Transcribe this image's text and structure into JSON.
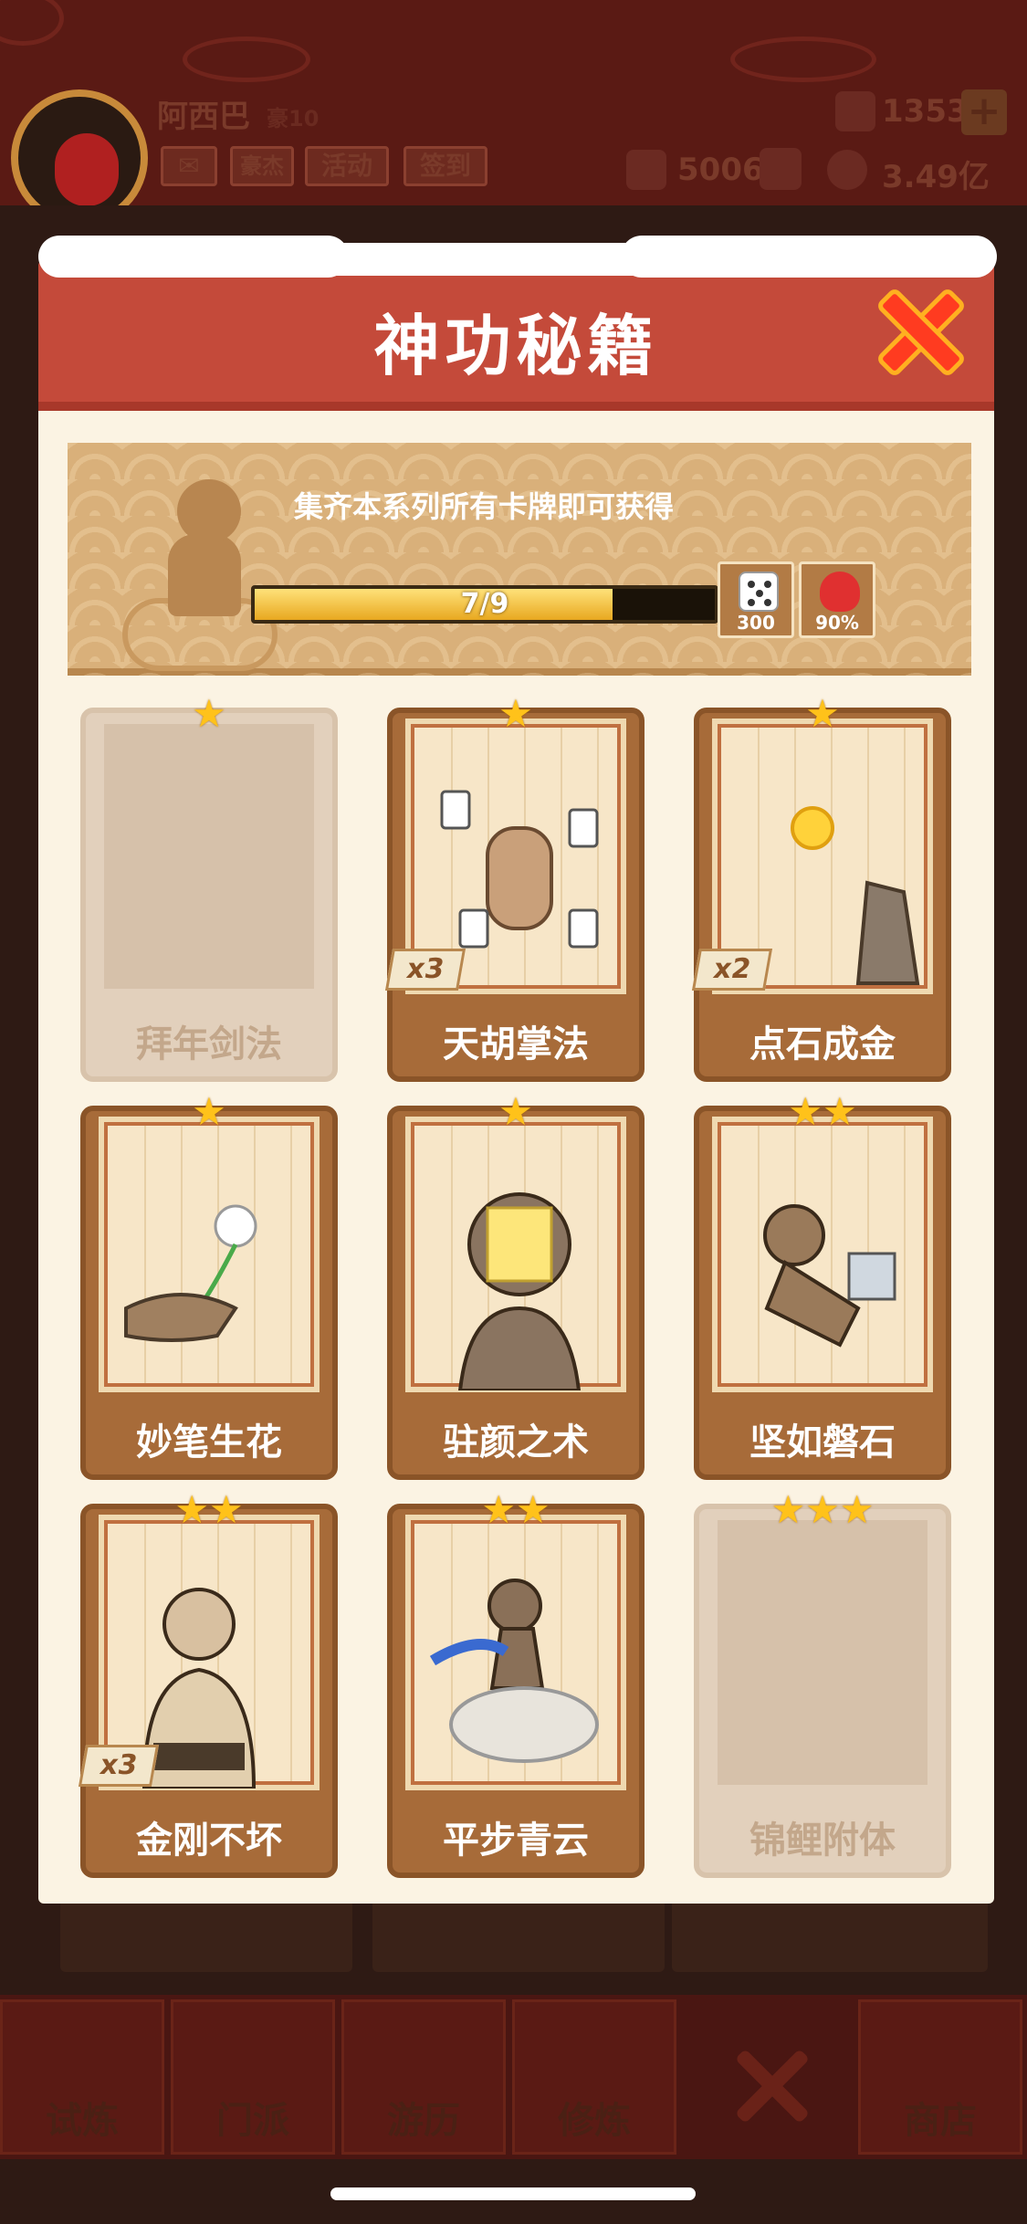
{
  "player": {
    "name": "阿西巴",
    "rank": "豪10"
  },
  "hud": {
    "buttons": [
      "豪杰",
      "活动",
      "签到"
    ],
    "gems": "1353",
    "tickets": "5006",
    "coins": "3.49亿"
  },
  "modal": {
    "title": "神功秘籍",
    "banner_text": "集齐本系列所有卡牌即可获得",
    "progress": {
      "label": "7/9",
      "collected": 7,
      "total": 9
    },
    "rewards": [
      {
        "icon": "dice-icon",
        "value": "300"
      },
      {
        "icon": "heart-icon",
        "value": "90%"
      }
    ]
  },
  "cards": [
    {
      "name": "拜年剑法",
      "stars": "★",
      "count": "",
      "locked": true
    },
    {
      "name": "天胡掌法",
      "stars": "★",
      "count": "x3",
      "locked": false
    },
    {
      "name": "点石成金",
      "stars": "★",
      "count": "x2",
      "locked": false
    },
    {
      "name": "妙笔生花",
      "stars": "★",
      "count": "",
      "locked": false
    },
    {
      "name": "驻颜之术",
      "stars": "★",
      "count": "",
      "locked": false
    },
    {
      "name": "坚如磐石",
      "stars": "★★",
      "count": "",
      "locked": false
    },
    {
      "name": "金刚不坏",
      "stars": "★★",
      "count": "x3",
      "locked": false
    },
    {
      "name": "平步青云",
      "stars": "★★",
      "count": "",
      "locked": false
    },
    {
      "name": "锦鲤附体",
      "stars": "★★★",
      "count": "",
      "locked": true
    }
  ],
  "nav": [
    "试炼",
    "门派",
    "游历",
    "修炼",
    "商店"
  ],
  "colors": {
    "header": "#c44a3a",
    "card": "#a76b39",
    "star": "#ffc21a",
    "progress": "#e8a820"
  }
}
